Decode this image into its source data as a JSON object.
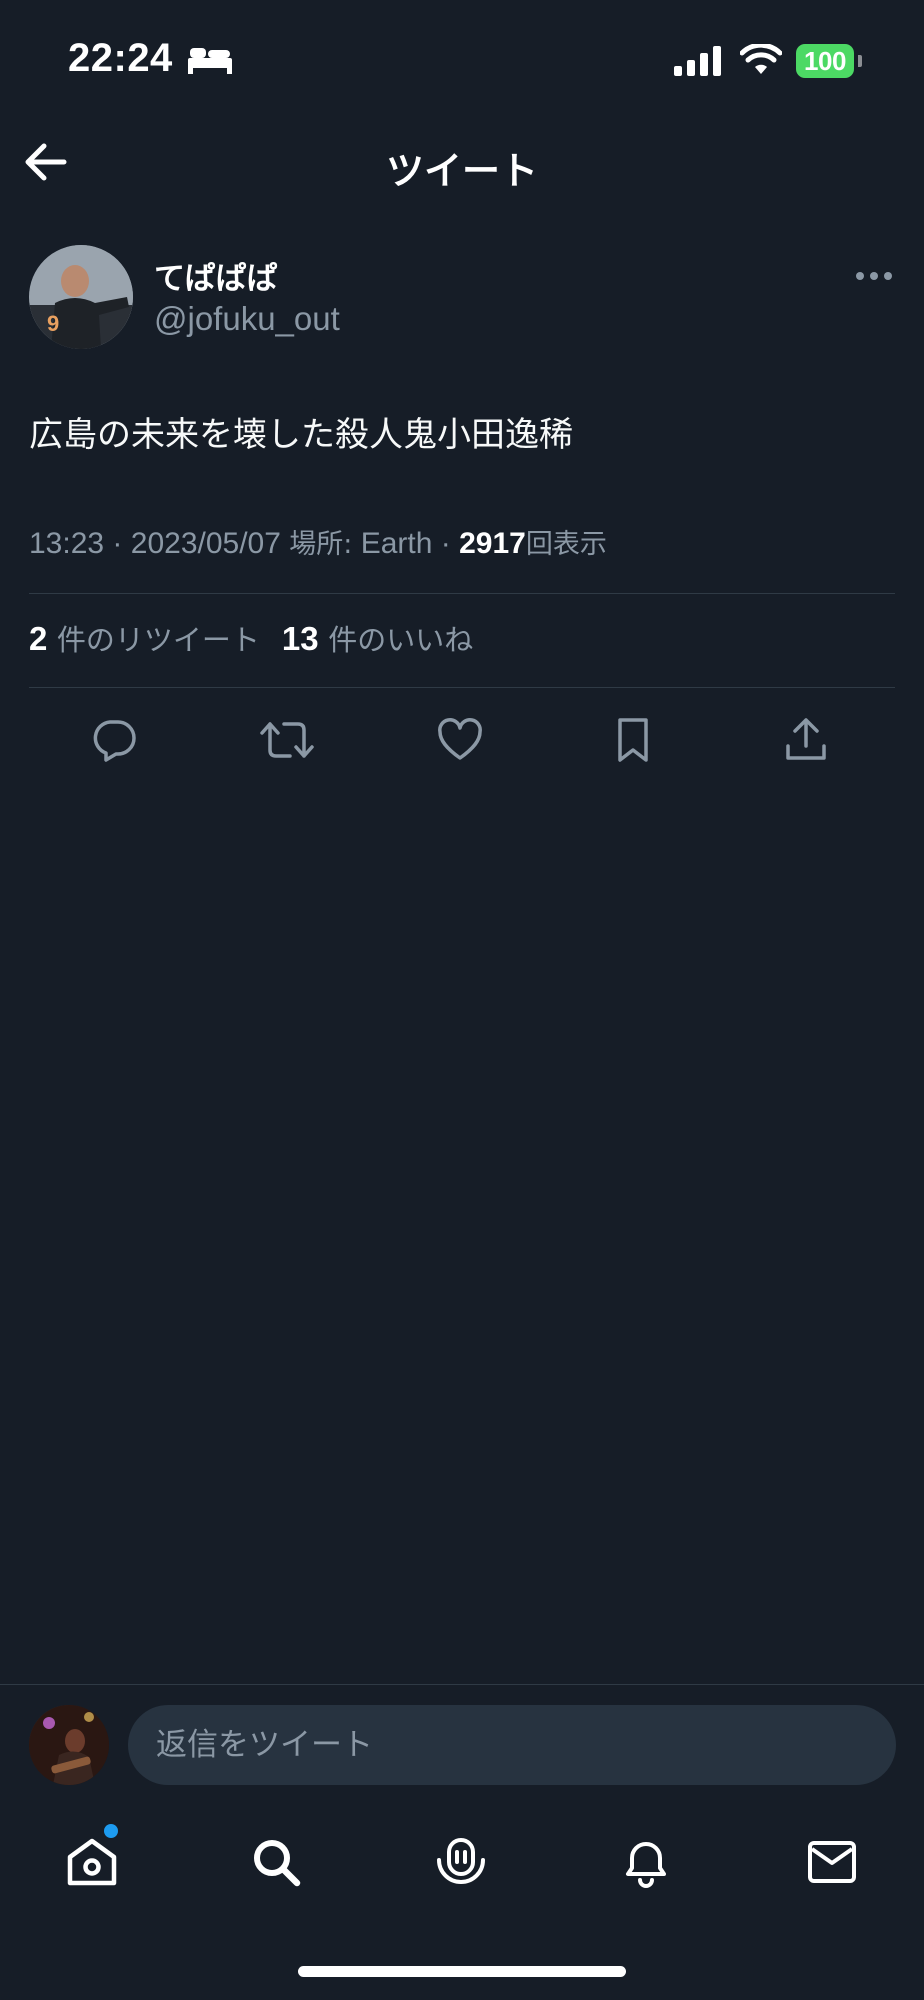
{
  "status_bar": {
    "time": "22:24",
    "battery": "100",
    "icons": [
      "bed-icon",
      "cellular-signal-icon",
      "wifi-icon",
      "battery-icon"
    ]
  },
  "header": {
    "title": "ツイート",
    "back_icon": "arrow-left-icon"
  },
  "tweet": {
    "author": {
      "display_name": "てぱぱぱ",
      "handle": "@jofuku_out"
    },
    "text": "広島の未来を壊した殺人鬼小田逸稀",
    "time": "13:23",
    "sep1": "·",
    "date": "2023/05/07",
    "location_label": "場所:",
    "location": "Earth",
    "sep2": "·",
    "views_count": "2917",
    "views_label": "回表示",
    "retweet_count": "2",
    "retweet_label": "件のリツイート",
    "like_count": "13",
    "like_label": "件のいいね",
    "actions": [
      "reply-icon",
      "retweet-icon",
      "like-icon",
      "bookmark-icon",
      "share-icon"
    ]
  },
  "reply_bar": {
    "placeholder": "返信をツイート"
  },
  "tab_bar": {
    "tabs": [
      "home-icon",
      "search-icon",
      "spaces-icon",
      "notifications-icon",
      "messages-icon"
    ]
  },
  "colors": {
    "background": "#161d27",
    "secondary_text": "#8b98a5",
    "accent": "#1d9bf0",
    "battery": "#4cd964"
  }
}
